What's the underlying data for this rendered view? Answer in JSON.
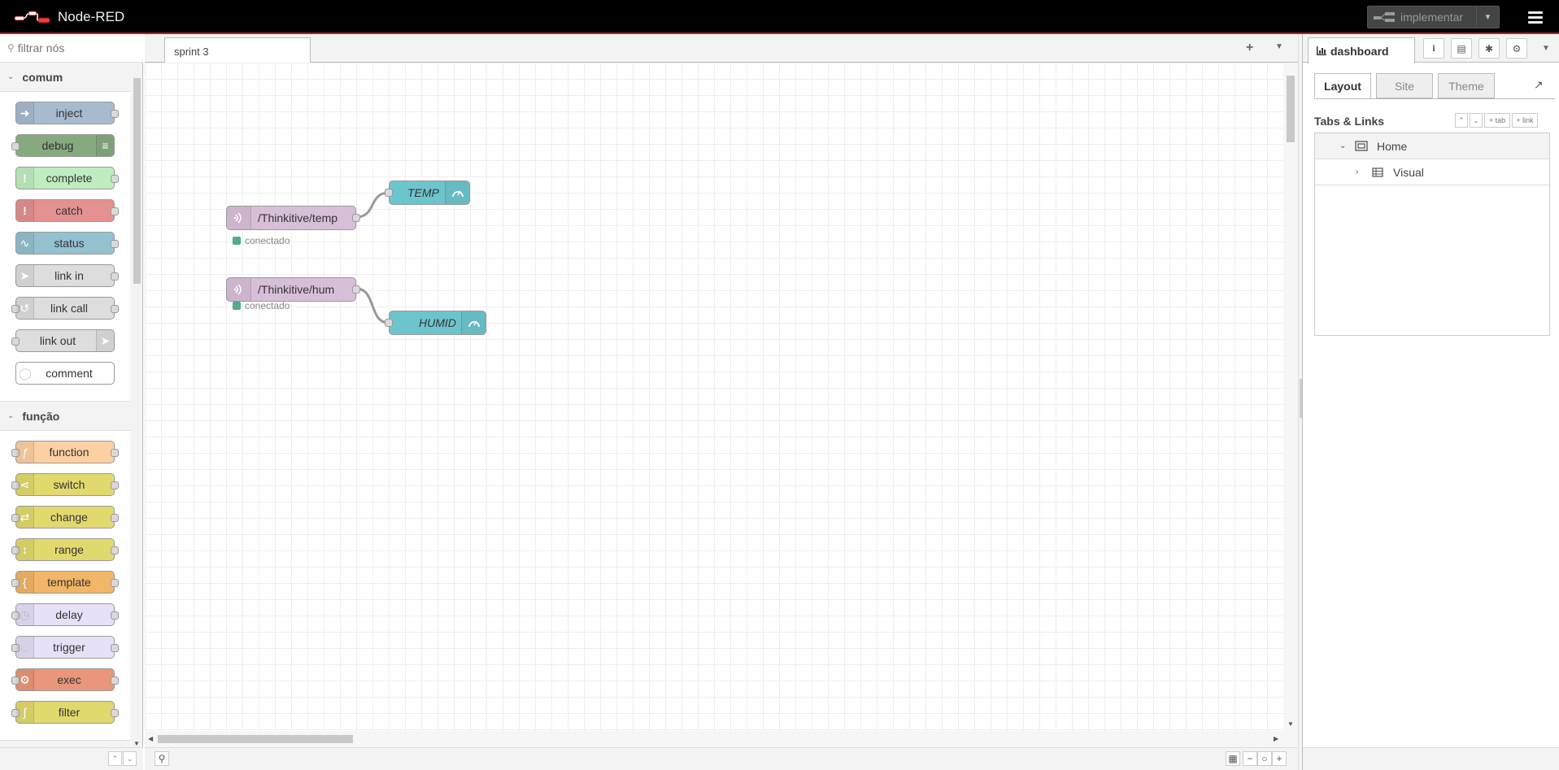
{
  "header": {
    "app_title": "Node-RED",
    "deploy_label": "implementar"
  },
  "palette": {
    "search_placeholder": "filtrar nós",
    "categories": [
      {
        "name": "comum",
        "nodes": [
          {
            "label": "inject",
            "color": "#a6bbcf",
            "icon": "arrow-right-icon"
          },
          {
            "label": "debug",
            "color": "#87a980",
            "icon": "list-icon"
          },
          {
            "label": "complete",
            "color": "#c0edc0",
            "icon": "exclamation-icon"
          },
          {
            "label": "catch",
            "color": "#e49191",
            "icon": "exclamation-icon"
          },
          {
            "label": "status",
            "color": "#94c1d0",
            "icon": "pulse-icon"
          },
          {
            "label": "link in",
            "color": "#dddddd",
            "icon": "link-in-icon"
          },
          {
            "label": "link call",
            "color": "#dddddd",
            "icon": "link-call-icon"
          },
          {
            "label": "link out",
            "color": "#dddddd",
            "icon": "link-out-icon"
          },
          {
            "label": "comment",
            "color": "#ffffff",
            "icon": "comment-icon"
          }
        ]
      },
      {
        "name": "função",
        "nodes": [
          {
            "label": "function",
            "color": "#fdd0a2",
            "icon": "function-icon"
          },
          {
            "label": "switch",
            "color": "#e2d96e",
            "icon": "switch-icon"
          },
          {
            "label": "change",
            "color": "#e2d96e",
            "icon": "shuffle-icon"
          },
          {
            "label": "range",
            "color": "#e2d96e",
            "icon": "range-icon"
          },
          {
            "label": "template",
            "color": "#f3b567",
            "icon": "brace-icon"
          },
          {
            "label": "delay",
            "color": "#e6e0f8",
            "icon": "clock-icon"
          },
          {
            "label": "trigger",
            "color": "#e6e0f8",
            "icon": "trigger-icon"
          },
          {
            "label": "exec",
            "color": "#e9967a",
            "icon": "gear-icon"
          },
          {
            "label": "filter",
            "color": "#e2d96e",
            "icon": "filter-icon"
          }
        ]
      }
    ]
  },
  "workspace": {
    "flow_tab": "sprint 3",
    "nodes": {
      "mqtt_temp": {
        "label": "/Thinkitive/temp",
        "status": "conectado",
        "color": "#d8bfd8"
      },
      "mqtt_hum": {
        "label": "/Thinkitive/hum",
        "status": "conectado",
        "color": "#d8bfd8"
      },
      "gauge_temp": {
        "label": "TEMP",
        "color": "#6cc5cc"
      },
      "gauge_hum": {
        "label": "HUMID",
        "color": "#6cc5cc"
      }
    },
    "status_color": "#55aa88"
  },
  "sidebar": {
    "active_tab": "dashboard",
    "dashboard": {
      "tabs": [
        "Layout",
        "Site",
        "Theme"
      ],
      "section_title": "Tabs & Links",
      "btn_tab": "+ tab",
      "btn_link": "+ link",
      "tree": [
        {
          "label": "Home",
          "level": 0,
          "expanded": true
        },
        {
          "label": "Visual",
          "level": 1,
          "expanded": false
        }
      ]
    }
  }
}
